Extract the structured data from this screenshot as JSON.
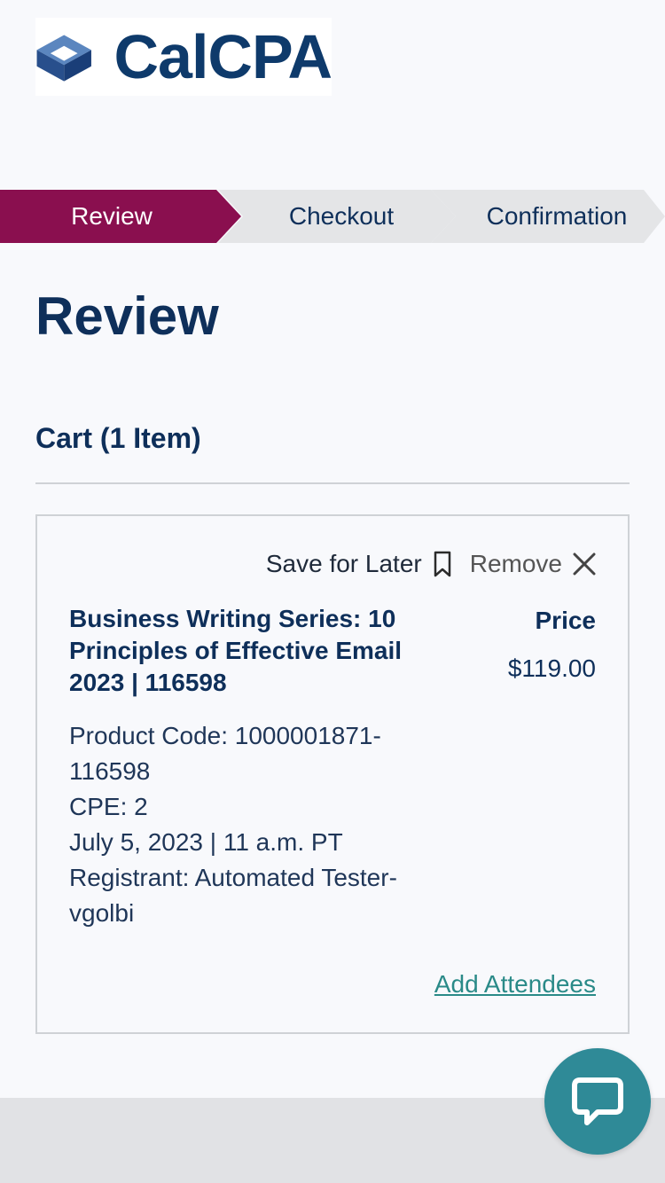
{
  "brand": {
    "name": "CalCPA"
  },
  "progress": {
    "steps": [
      {
        "label": "Review",
        "active": true
      },
      {
        "label": "Checkout",
        "active": false
      },
      {
        "label": "Confirmation",
        "active": false
      }
    ],
    "active_color": "#8a0f4f",
    "inactive_color": "#e4e5e7"
  },
  "page": {
    "title": "Review"
  },
  "cart": {
    "title": "Cart (1 Item)",
    "item": {
      "save_label": "Save for Later",
      "remove_label": "Remove",
      "product_title": "Business Writing Series: 10 Principles of Effective Email 2023 | 116598",
      "price_label": "Price",
      "price": "$119.00",
      "details": [
        "Product Code: 1000001871-116598",
        "CPE: 2",
        "July 5, 2023 | 11 a.m. PT",
        "Registrant: Automated Tester-vgolbi"
      ],
      "add_attendees_label": "Add Attendees"
    }
  },
  "icons": {
    "save": "bookmark-icon",
    "remove": "close-icon",
    "chat": "chat-icon"
  },
  "colors": {
    "accent": "#8a0f4f",
    "link": "#2a8a88",
    "chat": "#2f8a97",
    "text": "#0e2f5a"
  }
}
